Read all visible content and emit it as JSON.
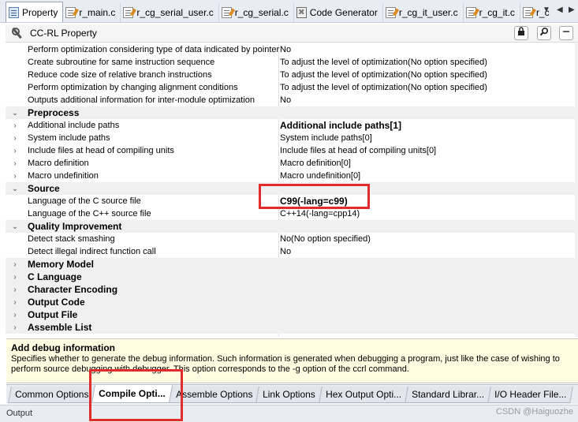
{
  "doc_tabs": [
    {
      "label": "Property",
      "icon": "property-icon",
      "active": true
    },
    {
      "label": "r_main.c",
      "icon": "c-file-icon"
    },
    {
      "label": "r_cg_serial_user.c",
      "icon": "c-file-icon"
    },
    {
      "label": "r_cg_serial.c",
      "icon": "c-file-icon"
    },
    {
      "label": "Code Generator",
      "icon": "code-generator-icon"
    },
    {
      "label": "r_cg_it_user.c",
      "icon": "c-file-icon"
    },
    {
      "label": "r_cg_it.c",
      "icon": "c-file-icon"
    },
    {
      "label": "r_c",
      "icon": "c-file-icon"
    }
  ],
  "panel": {
    "title": "CC-RL Property"
  },
  "rows": [
    {
      "type": "prop",
      "name": "Perform optimization considering type of data indicated by pointer",
      "value": "No"
    },
    {
      "type": "prop",
      "name": "Create subroutine for same instruction sequence",
      "value": "To adjust the level of optimization(No option specified)"
    },
    {
      "type": "prop",
      "name": "Reduce code size of relative branch instructions",
      "value": "To adjust the level of optimization(No option specified)"
    },
    {
      "type": "prop",
      "name": "Perform optimization by changing alignment conditions",
      "value": "To adjust the level of optimization(No option specified)"
    },
    {
      "type": "prop",
      "name": "Outputs additional information for inter-module optimization",
      "value": "No"
    },
    {
      "type": "cat",
      "name": "Preprocess",
      "expanded": true
    },
    {
      "type": "prop",
      "name": "Additional include paths",
      "value": "Additional include paths[1]",
      "expandable": true,
      "bold": true
    },
    {
      "type": "prop",
      "name": "System include paths",
      "value": "System include paths[0]",
      "expandable": true
    },
    {
      "type": "prop",
      "name": "Include files at head of compiling units",
      "value": "Include files at head of compiling units[0]",
      "expandable": true
    },
    {
      "type": "prop",
      "name": "Macro definition",
      "value": "Macro definition[0]",
      "expandable": true
    },
    {
      "type": "prop",
      "name": "Macro undefinition",
      "value": "Macro undefinition[0]",
      "expandable": true
    },
    {
      "type": "cat",
      "name": "Source",
      "expanded": true
    },
    {
      "type": "prop",
      "name": "Language of the C source file",
      "value": "C99(-lang=c99)",
      "bold": true
    },
    {
      "type": "prop",
      "name": "Language of the C++ source file",
      "value": "C++14(-lang=cpp14)"
    },
    {
      "type": "cat",
      "name": "Quality Improvement",
      "expanded": true
    },
    {
      "type": "prop",
      "name": "Detect stack smashing",
      "value": "No(No option specified)"
    },
    {
      "type": "prop",
      "name": "Detect illegal indirect function call",
      "value": "No"
    },
    {
      "type": "cat",
      "name": "Memory Model",
      "expanded": false
    },
    {
      "type": "cat",
      "name": "C Language",
      "expanded": false
    },
    {
      "type": "cat",
      "name": "Character Encoding",
      "expanded": false
    },
    {
      "type": "cat",
      "name": "Output Code",
      "expanded": false
    },
    {
      "type": "cat",
      "name": "Output File",
      "expanded": false
    },
    {
      "type": "cat",
      "name": "Assemble List",
      "expanded": false
    }
  ],
  "description": {
    "title": "Add debug information",
    "text": "Specifies whether to generate the debug information. Such information is generated when debugging a program, just like the case of wishing to perform source debugging with debugger. This option corresponds to the -g option of the ccrl command."
  },
  "bottom_tabs": [
    {
      "label": "Common Options",
      "active": false
    },
    {
      "label": "Compile Opti...",
      "active": true
    },
    {
      "label": "Assemble Options",
      "active": false
    },
    {
      "label": "Link Options",
      "active": false
    },
    {
      "label": "Hex Output Opti...",
      "active": false
    },
    {
      "label": "Standard Librar...",
      "active": false
    },
    {
      "label": "I/O Header File...",
      "active": false
    }
  ],
  "output_label": "Output",
  "watermark": "CSDN @Haiguozhe",
  "colors": {
    "highlight_box": "#e22c2c",
    "description_bg": "#fffbe0",
    "category_bg": "#f0f0f0"
  }
}
